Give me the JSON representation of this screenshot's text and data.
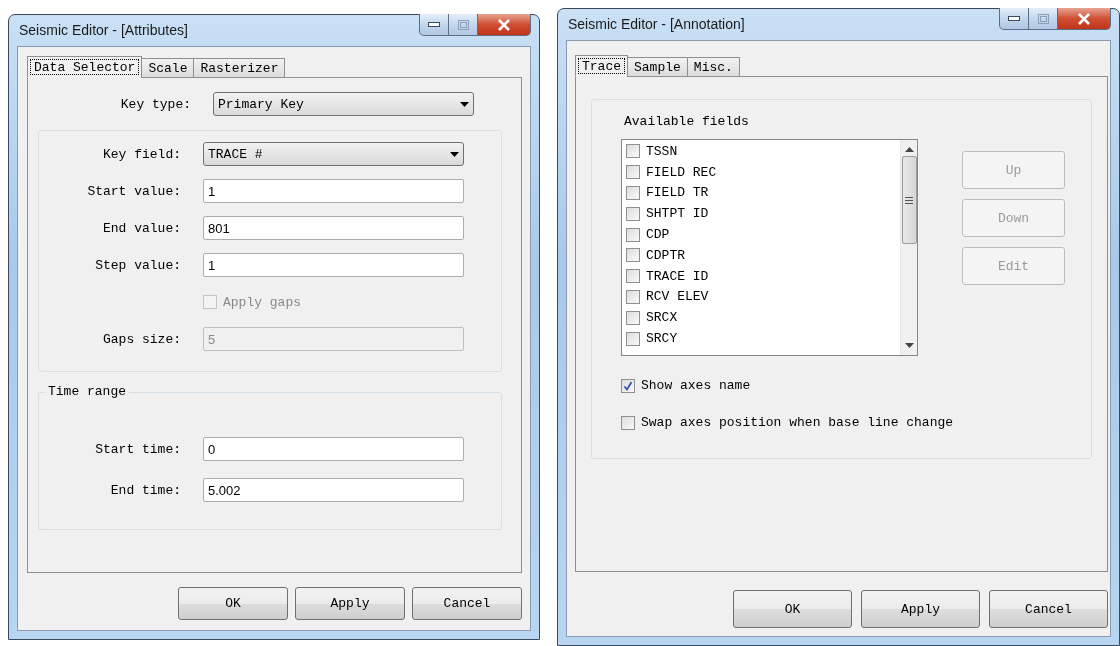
{
  "attributes_dialog": {
    "title": "Seismic Editor - [Attributes]",
    "tabs": [
      {
        "label": "Data Selector",
        "selected": true
      },
      {
        "label": "Scale",
        "selected": false
      },
      {
        "label": "Rasterizer",
        "selected": false
      }
    ],
    "key_type": {
      "label": "Key type:",
      "value": "Primary Key"
    },
    "key_group": [
      {
        "kind": "dropdown",
        "label": "Key field:",
        "value": "TRACE #",
        "disabled": false
      },
      {
        "kind": "text",
        "label": "Start value:",
        "value": "1",
        "disabled": false
      },
      {
        "kind": "text",
        "label": "End value:",
        "value": "801",
        "disabled": false
      },
      {
        "kind": "text",
        "label": "Step value:",
        "value": "1",
        "disabled": false
      },
      {
        "kind": "checkbox",
        "label": "Apply gaps",
        "checked": false,
        "disabled": true
      },
      {
        "kind": "text",
        "label": "Gaps size:",
        "value": "5",
        "disabled": true
      }
    ],
    "time_range": {
      "title": "Time range",
      "fields": [
        {
          "kind": "text",
          "label": "Start time:",
          "value": "0",
          "disabled": false
        },
        {
          "kind": "text",
          "label": "End time:",
          "value": "5.002",
          "disabled": false
        }
      ]
    },
    "buttons": [
      {
        "label": "OK"
      },
      {
        "label": "Apply"
      },
      {
        "label": "Cancel"
      }
    ]
  },
  "annotation_dialog": {
    "title": "Seismic Editor - [Annotation]",
    "tabs": [
      {
        "label": "Trace",
        "selected": true
      },
      {
        "label": "Sample",
        "selected": false
      },
      {
        "label": "Misc.",
        "selected": false
      }
    ],
    "available_fields": {
      "label": "Available fields",
      "items": [
        {
          "label": "TSSN",
          "checked": false
        },
        {
          "label": "FIELD REC",
          "checked": false
        },
        {
          "label": "FIELD TR",
          "checked": false
        },
        {
          "label": "SHTPT ID",
          "checked": false
        },
        {
          "label": "CDP",
          "checked": false
        },
        {
          "label": "CDPTR",
          "checked": false
        },
        {
          "label": "TRACE ID",
          "checked": false
        },
        {
          "label": "RCV ELEV",
          "checked": false
        },
        {
          "label": "SRCX",
          "checked": false
        },
        {
          "label": "SRCY",
          "checked": false
        }
      ]
    },
    "side_buttons": [
      {
        "label": "Up",
        "disabled": true
      },
      {
        "label": "Down",
        "disabled": true
      },
      {
        "label": "Edit",
        "disabled": true
      }
    ],
    "options": [
      {
        "label": "Show axes name",
        "checked": true
      },
      {
        "label": "Swap axes position when base line change",
        "checked": false
      }
    ],
    "buttons": [
      {
        "label": "OK"
      },
      {
        "label": "Apply"
      },
      {
        "label": "Cancel"
      }
    ]
  }
}
